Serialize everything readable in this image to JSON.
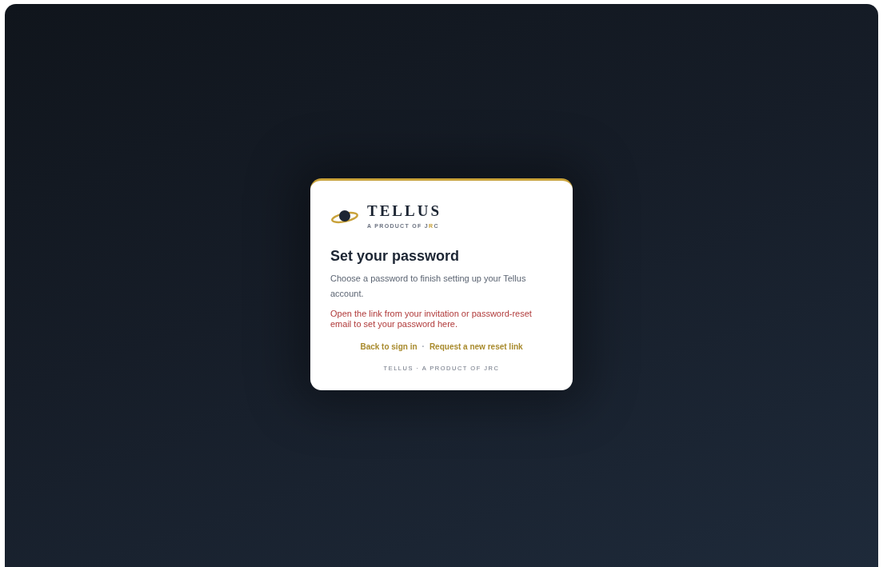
{
  "brand": {
    "name": "TELLUS",
    "tagline": [
      {
        "text": "A PRODUCT OF J",
        "accent": false
      },
      {
        "text": "R",
        "accent": true
      },
      {
        "text": "C",
        "accent": false
      }
    ]
  },
  "heading": "Set your password",
  "description": "Choose a password to finish setting up your Tellus account.",
  "error": "Open the link from your invitation or password-reset email to set your password here.",
  "links": [
    {
      "label": "Back to sign in"
    },
    {
      "label": "Request a new reset link"
    }
  ],
  "separator": "·",
  "footer": "TELLUS · A PRODUCT OF JRC"
}
